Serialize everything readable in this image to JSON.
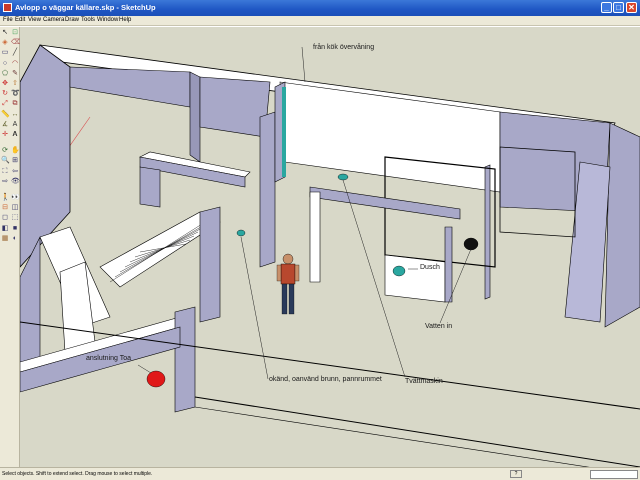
{
  "window": {
    "title": "Avlopp o väggar källare.skp - SketchUp",
    "minimize": "_",
    "maximize": "□",
    "close": "✕"
  },
  "menu": [
    "File",
    "Edit",
    "View",
    "Camera",
    "Draw",
    "Tools",
    "Window",
    "Help"
  ],
  "tools": [
    "select-icon",
    "component-icon",
    "paint-bucket-icon",
    "eraser-icon",
    "rectangle-icon",
    "line-icon",
    "circle-icon",
    "arc-icon",
    "polygon-icon",
    "freehand-icon",
    "move-icon",
    "push-pull-icon",
    "rotate-icon",
    "follow-me-icon",
    "scale-icon",
    "offset-icon",
    "tape-measure-icon",
    "dimension-icon",
    "protractor-icon",
    "text-icon",
    "axes-icon",
    "3d-text-icon",
    "orbit-icon",
    "pan-icon",
    "zoom-icon",
    "zoom-window-icon",
    "zoom-extents-icon",
    "previous-icon",
    "next-icon",
    "position-camera-icon",
    "walk-icon",
    "look-around-icon",
    "section-plane-icon",
    "xray-icon",
    "back-edges-icon",
    "wireframe-icon",
    "hidden-line-icon",
    "shaded-icon",
    "textures-icon",
    "monochrome-icon"
  ],
  "annotations": {
    "fran_kok": "från kök övervåning",
    "dusch": "Dusch",
    "vatten_in": "Vatten in",
    "anslutning_toa": "anslutning Toa",
    "okand_brunn": "okänd, oanvänd brunn, pannrummet",
    "tvattmaskin": "Tvättmaskin"
  },
  "status": {
    "text": "Select objects. Shift to extend select. Drag mouse to select multiple.",
    "help": "?",
    "vcb_label": ""
  },
  "colors": {
    "wall_side": "#a8a8c8",
    "wall_top": "#ffffff",
    "floor": "#d8d8c8",
    "drain_teal": "#2aa7a0",
    "drain_red": "#e01818",
    "drain_black": "#111111"
  }
}
